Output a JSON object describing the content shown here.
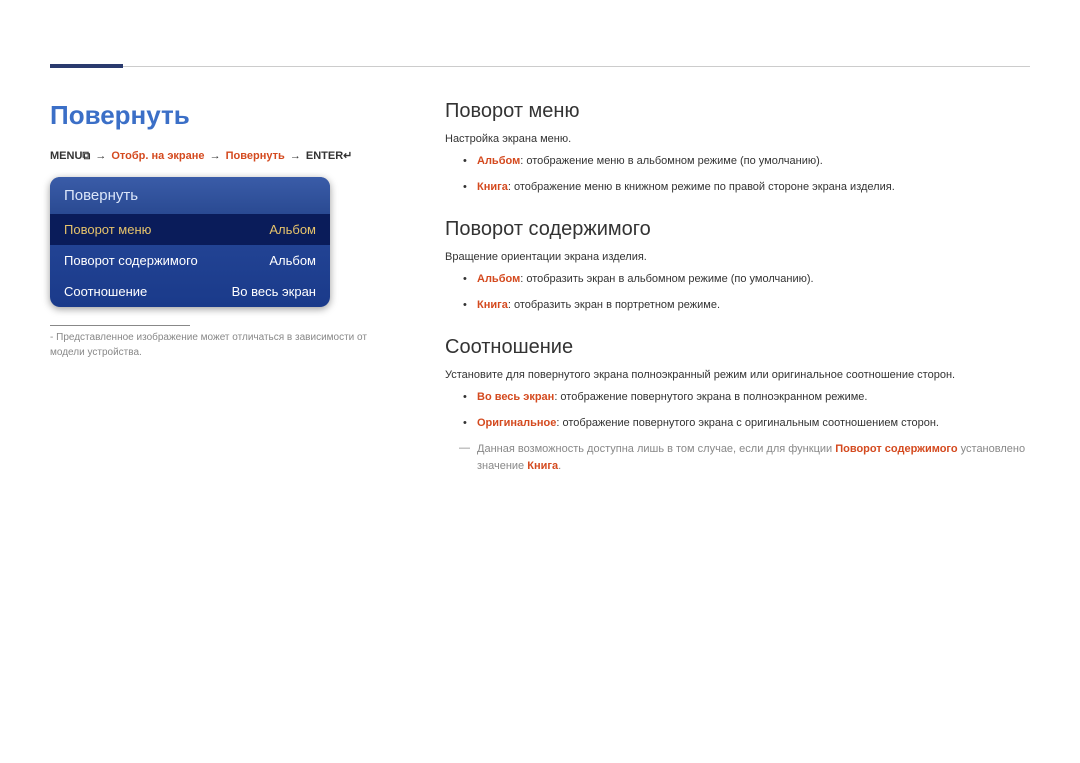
{
  "page_title": "Повернуть",
  "breadcrumb": {
    "menu": "MENU",
    "menu_icon": "⧉",
    "sep": "→",
    "p1": "Отобр. на экране",
    "p2": "Повернуть",
    "enter": "ENTER",
    "enter_icon": "↵"
  },
  "menu_box": {
    "header": "Повернуть",
    "rows": [
      {
        "label": "Поворот меню",
        "value": "Альбом",
        "selected": true
      },
      {
        "label": "Поворот содержимого",
        "value": "Альбом",
        "selected": false
      },
      {
        "label": "Соотношение",
        "value": "Во весь экран",
        "selected": false
      }
    ]
  },
  "footnote_dash": "-",
  "footnote": "Представленное изображение может отличаться в зависимости от модели устройства.",
  "sections": [
    {
      "title": "Поворот меню",
      "desc": "Настройка экрана меню.",
      "bullets": [
        {
          "bold": "Альбом",
          "text": ": отображение меню в альбомном режиме (по умолчанию)."
        },
        {
          "bold": "Книга",
          "text": ": отображение меню в книжном режиме по правой стороне экрана изделия."
        }
      ]
    },
    {
      "title": "Поворот содержимого",
      "desc": "Вращение ориентации экрана изделия.",
      "bullets": [
        {
          "bold": "Альбом",
          "text": ": отобразить экран в альбомном режиме (по умолчанию)."
        },
        {
          "bold": "Книга",
          "text": ": отобразить экран в портретном режиме."
        }
      ]
    },
    {
      "title": "Соотношение",
      "desc": "Установите для повернутого экрана полноэкранный режим или оригинальное соотношение сторон.",
      "bullets": [
        {
          "bold": "Во весь экран",
          "text": ": отображение повернутого экрана в полноэкранном режиме."
        },
        {
          "bold": "Оригинальное",
          "text": ": отображение повернутого экрана с оригинальным соотношением сторон."
        }
      ],
      "note_pre": "Данная возможность доступна лишь в том случае, если для функции ",
      "note_accent1": "Поворот содержимого",
      "note_mid": " установлено значение ",
      "note_accent2": "Книга",
      "note_post": "."
    }
  ]
}
